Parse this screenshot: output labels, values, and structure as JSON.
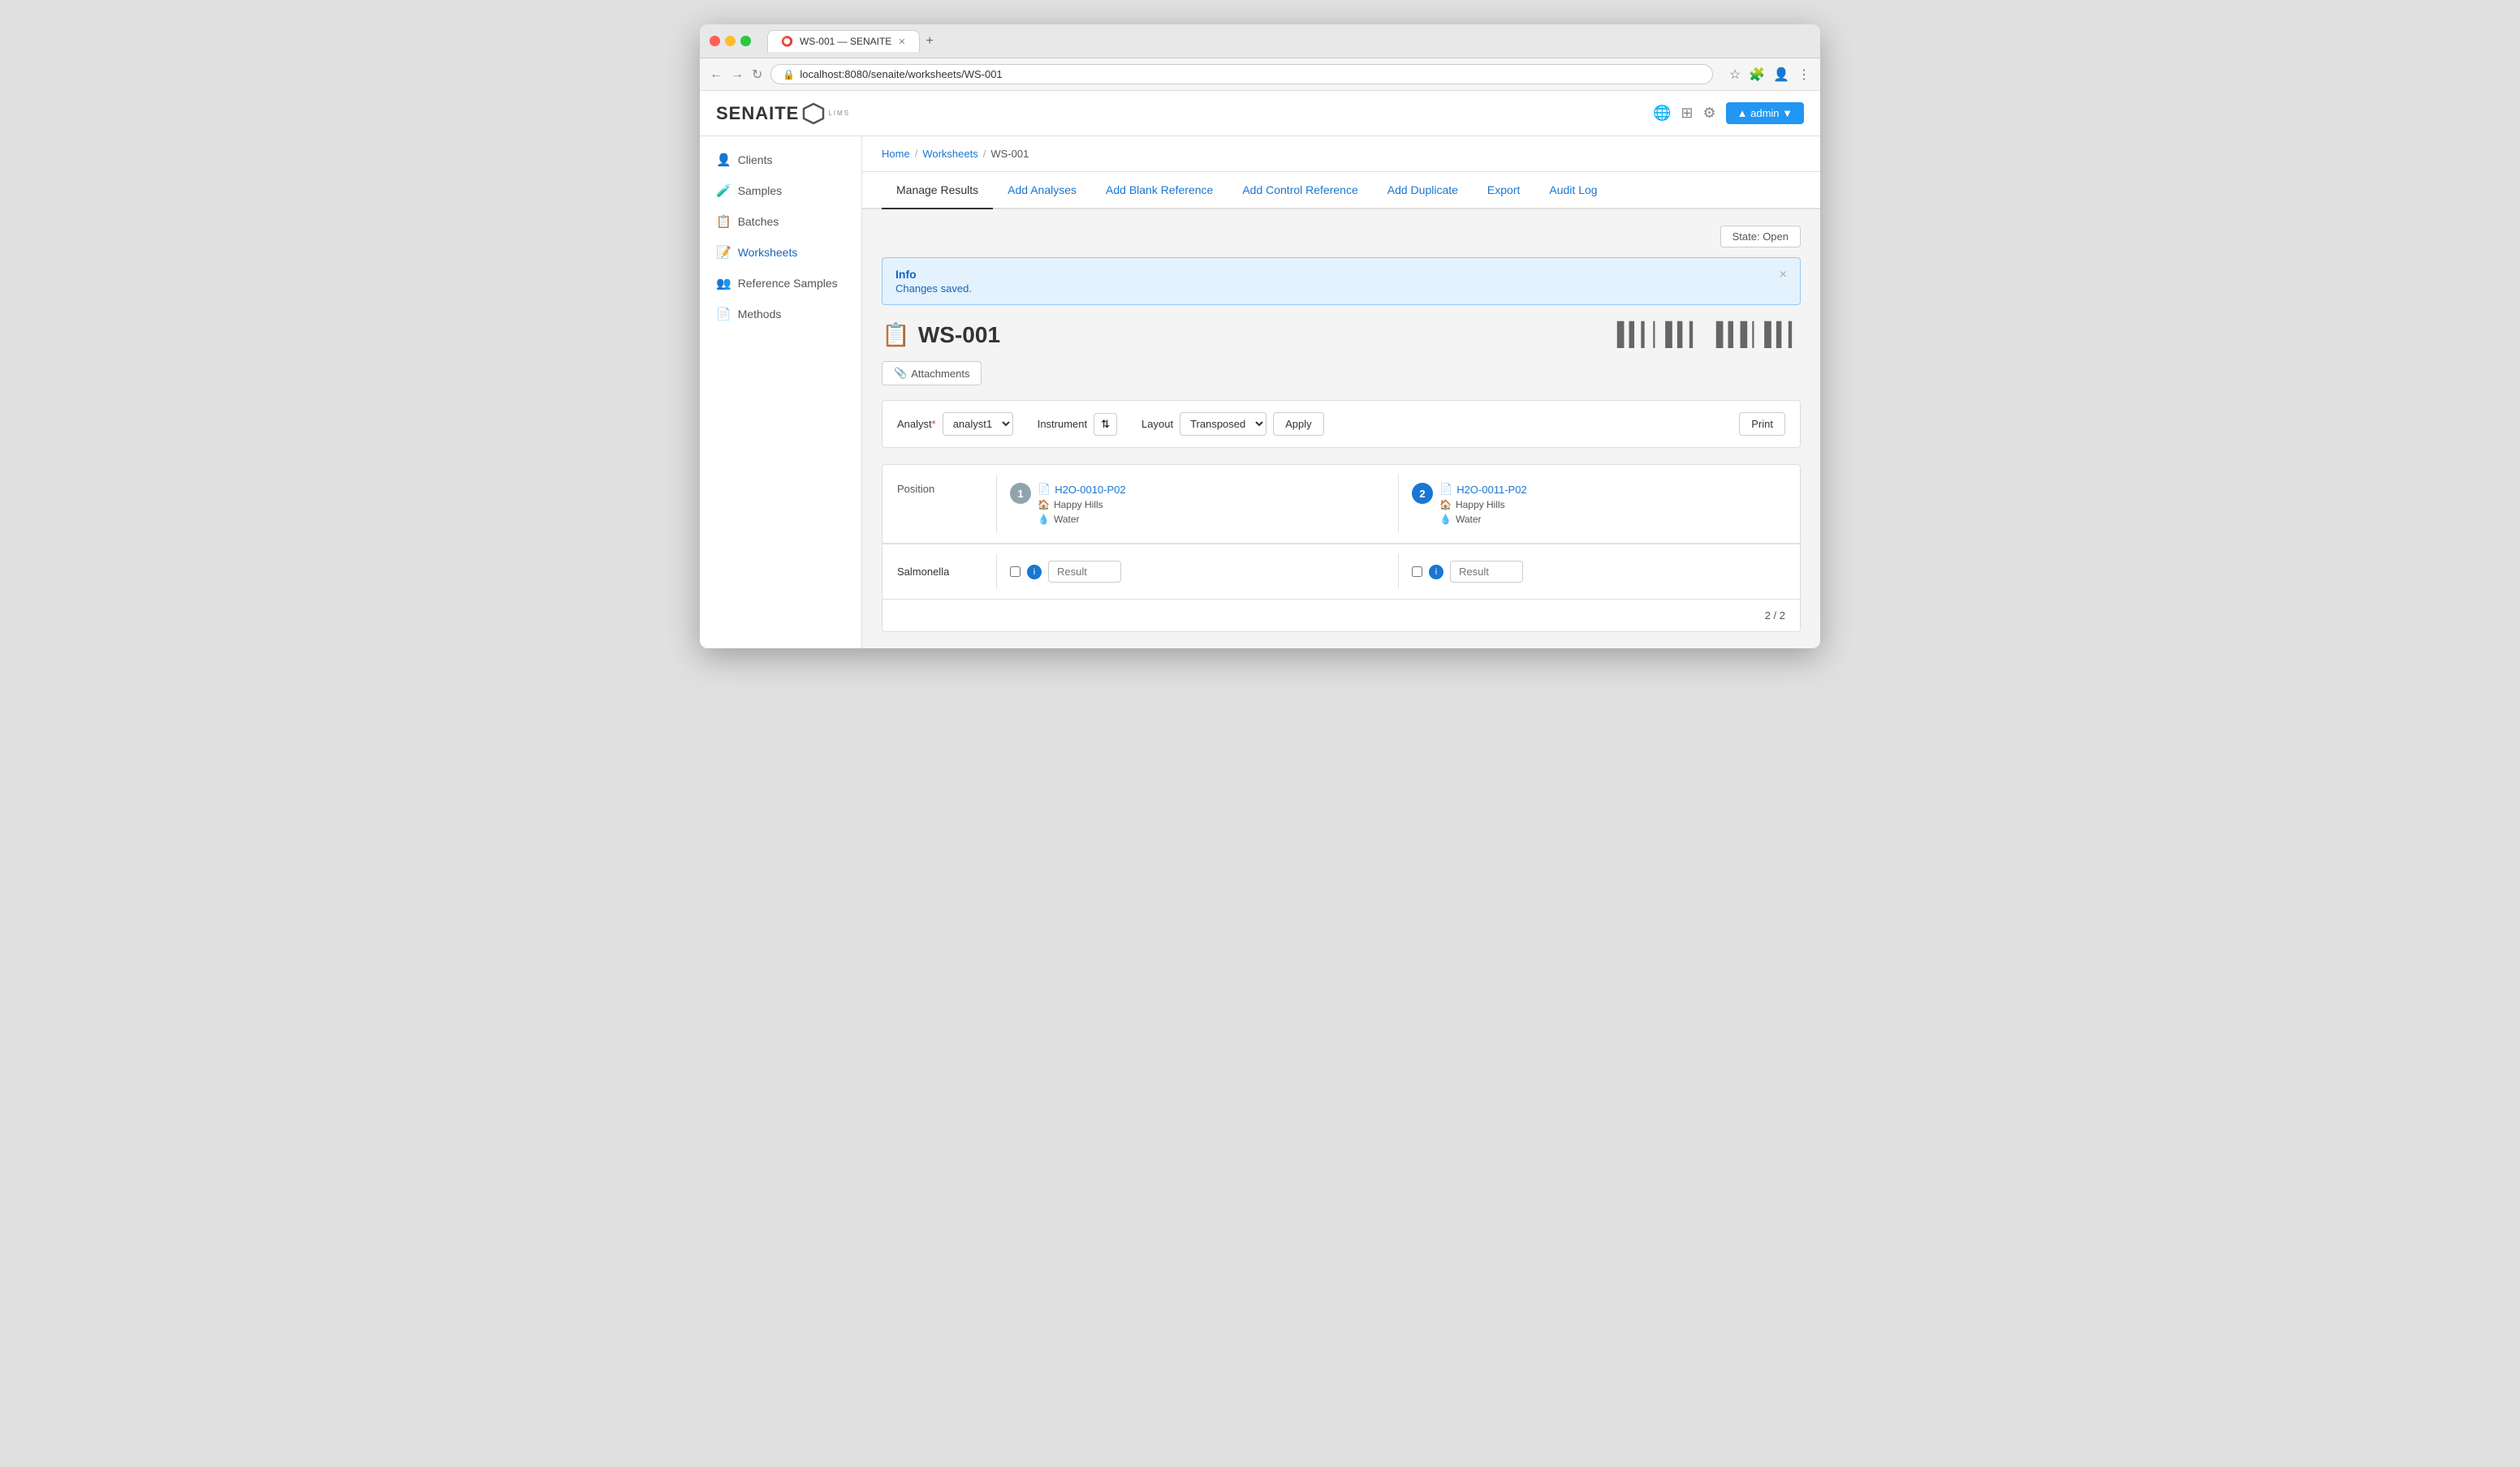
{
  "browser": {
    "tab_title": "WS-001 — SENAITE",
    "url": "localhost:8080/senaite/worksheets/WS-001",
    "plus_icon": "+",
    "back_icon": "←",
    "forward_icon": "→",
    "refresh_icon": "↻"
  },
  "topbar": {
    "logo": "SENAITE",
    "logo_sub": "LIMS",
    "admin_label": "▲ admin ▼",
    "globe_icon": "🌐",
    "grid_icon": "⊞",
    "gear_icon": "⚙"
  },
  "sidebar": {
    "items": [
      {
        "id": "clients",
        "label": "Clients",
        "icon": "👤"
      },
      {
        "id": "samples",
        "label": "Samples",
        "icon": "🧪"
      },
      {
        "id": "batches",
        "label": "Batches",
        "icon": "📋"
      },
      {
        "id": "worksheets",
        "label": "Worksheets",
        "icon": "📝",
        "active": true
      },
      {
        "id": "reference-samples",
        "label": "Reference Samples",
        "icon": "👥"
      },
      {
        "id": "methods",
        "label": "Methods",
        "icon": "📄"
      }
    ]
  },
  "breadcrumb": {
    "home": "Home",
    "worksheets": "Worksheets",
    "current": "WS-001"
  },
  "tabs": [
    {
      "id": "manage-results",
      "label": "Manage Results",
      "active": true
    },
    {
      "id": "add-analyses",
      "label": "Add Analyses"
    },
    {
      "id": "add-blank-reference",
      "label": "Add Blank Reference"
    },
    {
      "id": "add-control-reference",
      "label": "Add Control Reference"
    },
    {
      "id": "add-duplicate",
      "label": "Add Duplicate"
    },
    {
      "id": "export",
      "label": "Export"
    },
    {
      "id": "audit-log",
      "label": "Audit Log"
    }
  ],
  "state_badge": "State: Open",
  "info_box": {
    "title": "Info",
    "message": "Changes saved.",
    "close": "×"
  },
  "worksheet": {
    "title": "WS-001",
    "attachments_label": "Attachments",
    "analyst_label": "Analyst",
    "analyst_required": "*",
    "analyst_value": "analyst1",
    "instrument_label": "Instrument",
    "layout_label": "Layout",
    "layout_value": "Transposed",
    "apply_label": "Apply",
    "print_label": "Print",
    "position_label": "Position",
    "pagination": "2 / 2"
  },
  "positions": [
    {
      "num": "1",
      "sample_id": "H2O-0010-P02",
      "client": "Happy Hills",
      "sample_type": "Water",
      "active": false
    },
    {
      "num": "2",
      "sample_id": "H2O-0011-P02",
      "client": "Happy Hills",
      "sample_type": "Water",
      "active": true
    }
  ],
  "analyses": [
    {
      "name": "Salmonella",
      "results": [
        {
          "placeholder": "Result"
        },
        {
          "placeholder": "Result"
        }
      ]
    }
  ],
  "icons": {
    "worksheet_icon": "📋",
    "barcode1": "▦",
    "barcode2": "▦",
    "attachment_pin": "📎",
    "sample_doc": "📄",
    "person": "👤",
    "flask": "🧪",
    "info_char": "i"
  }
}
